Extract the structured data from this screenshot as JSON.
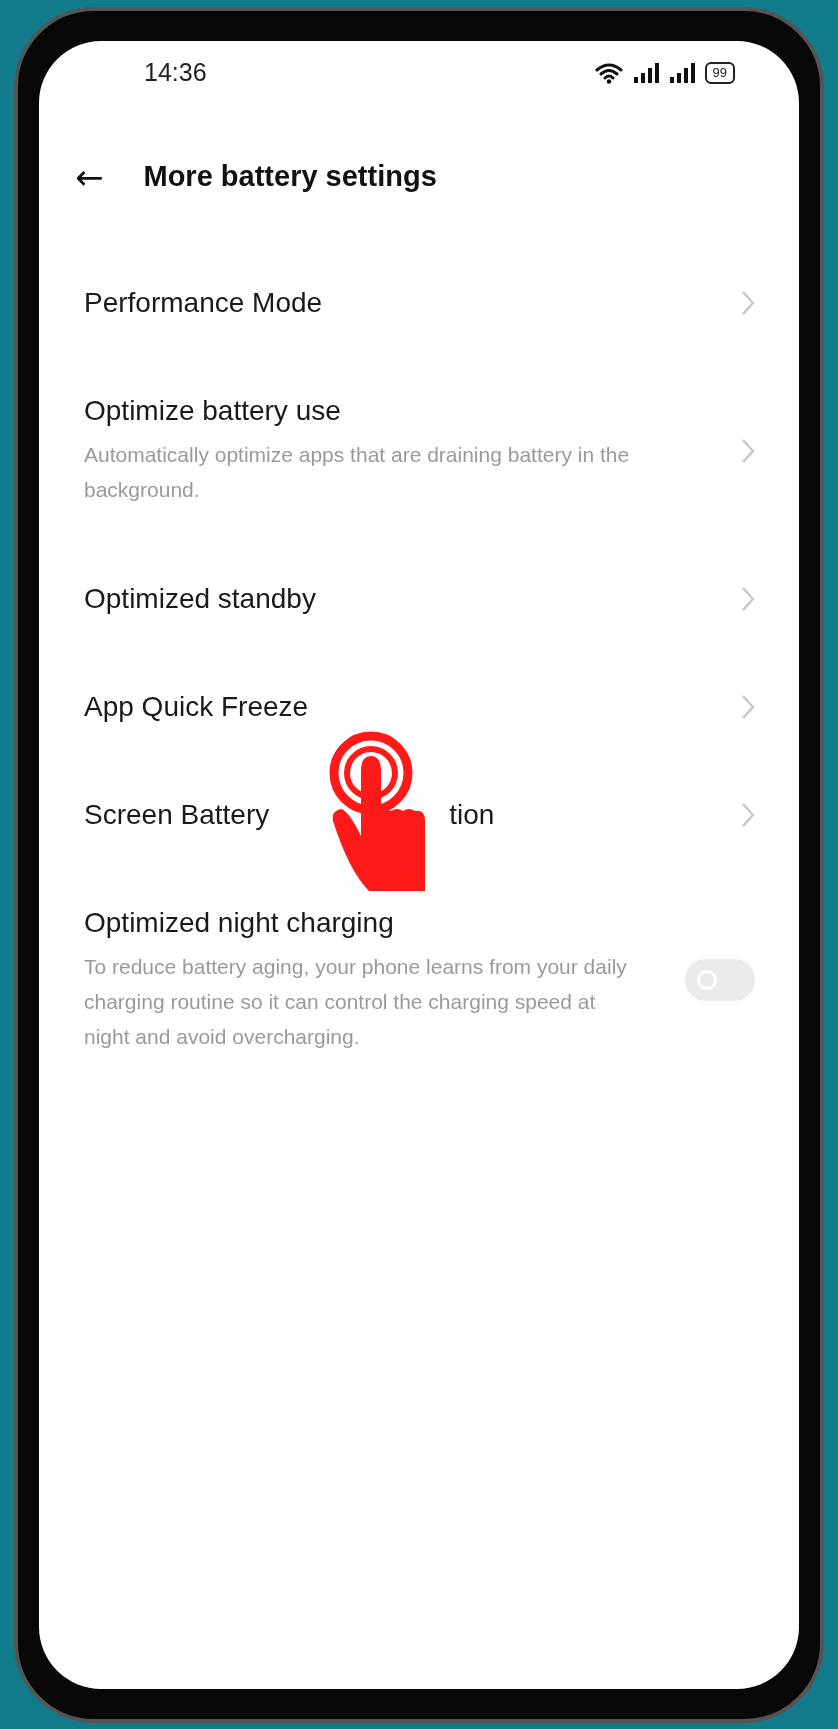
{
  "status_bar": {
    "time": "14:36",
    "battery": "99"
  },
  "header": {
    "back": "←",
    "title": "More battery settings"
  },
  "rows": [
    {
      "kind": "link",
      "title": "Performance Mode"
    },
    {
      "kind": "link",
      "title": "Optimize battery use",
      "subtitle": "Automatically optimize apps that are draining battery in the background."
    },
    {
      "kind": "link",
      "title": "Optimized standby"
    },
    {
      "kind": "link",
      "title": "App Quick Freeze"
    },
    {
      "kind": "link",
      "title_parts": [
        "Screen Battery",
        "tion"
      ]
    },
    {
      "kind": "toggle",
      "title": "Optimized night charging",
      "subtitle": "To reduce battery aging, your phone learns from your daily charging routine so it can control the charging speed at night and avoid overcharging.",
      "on": false
    }
  ]
}
